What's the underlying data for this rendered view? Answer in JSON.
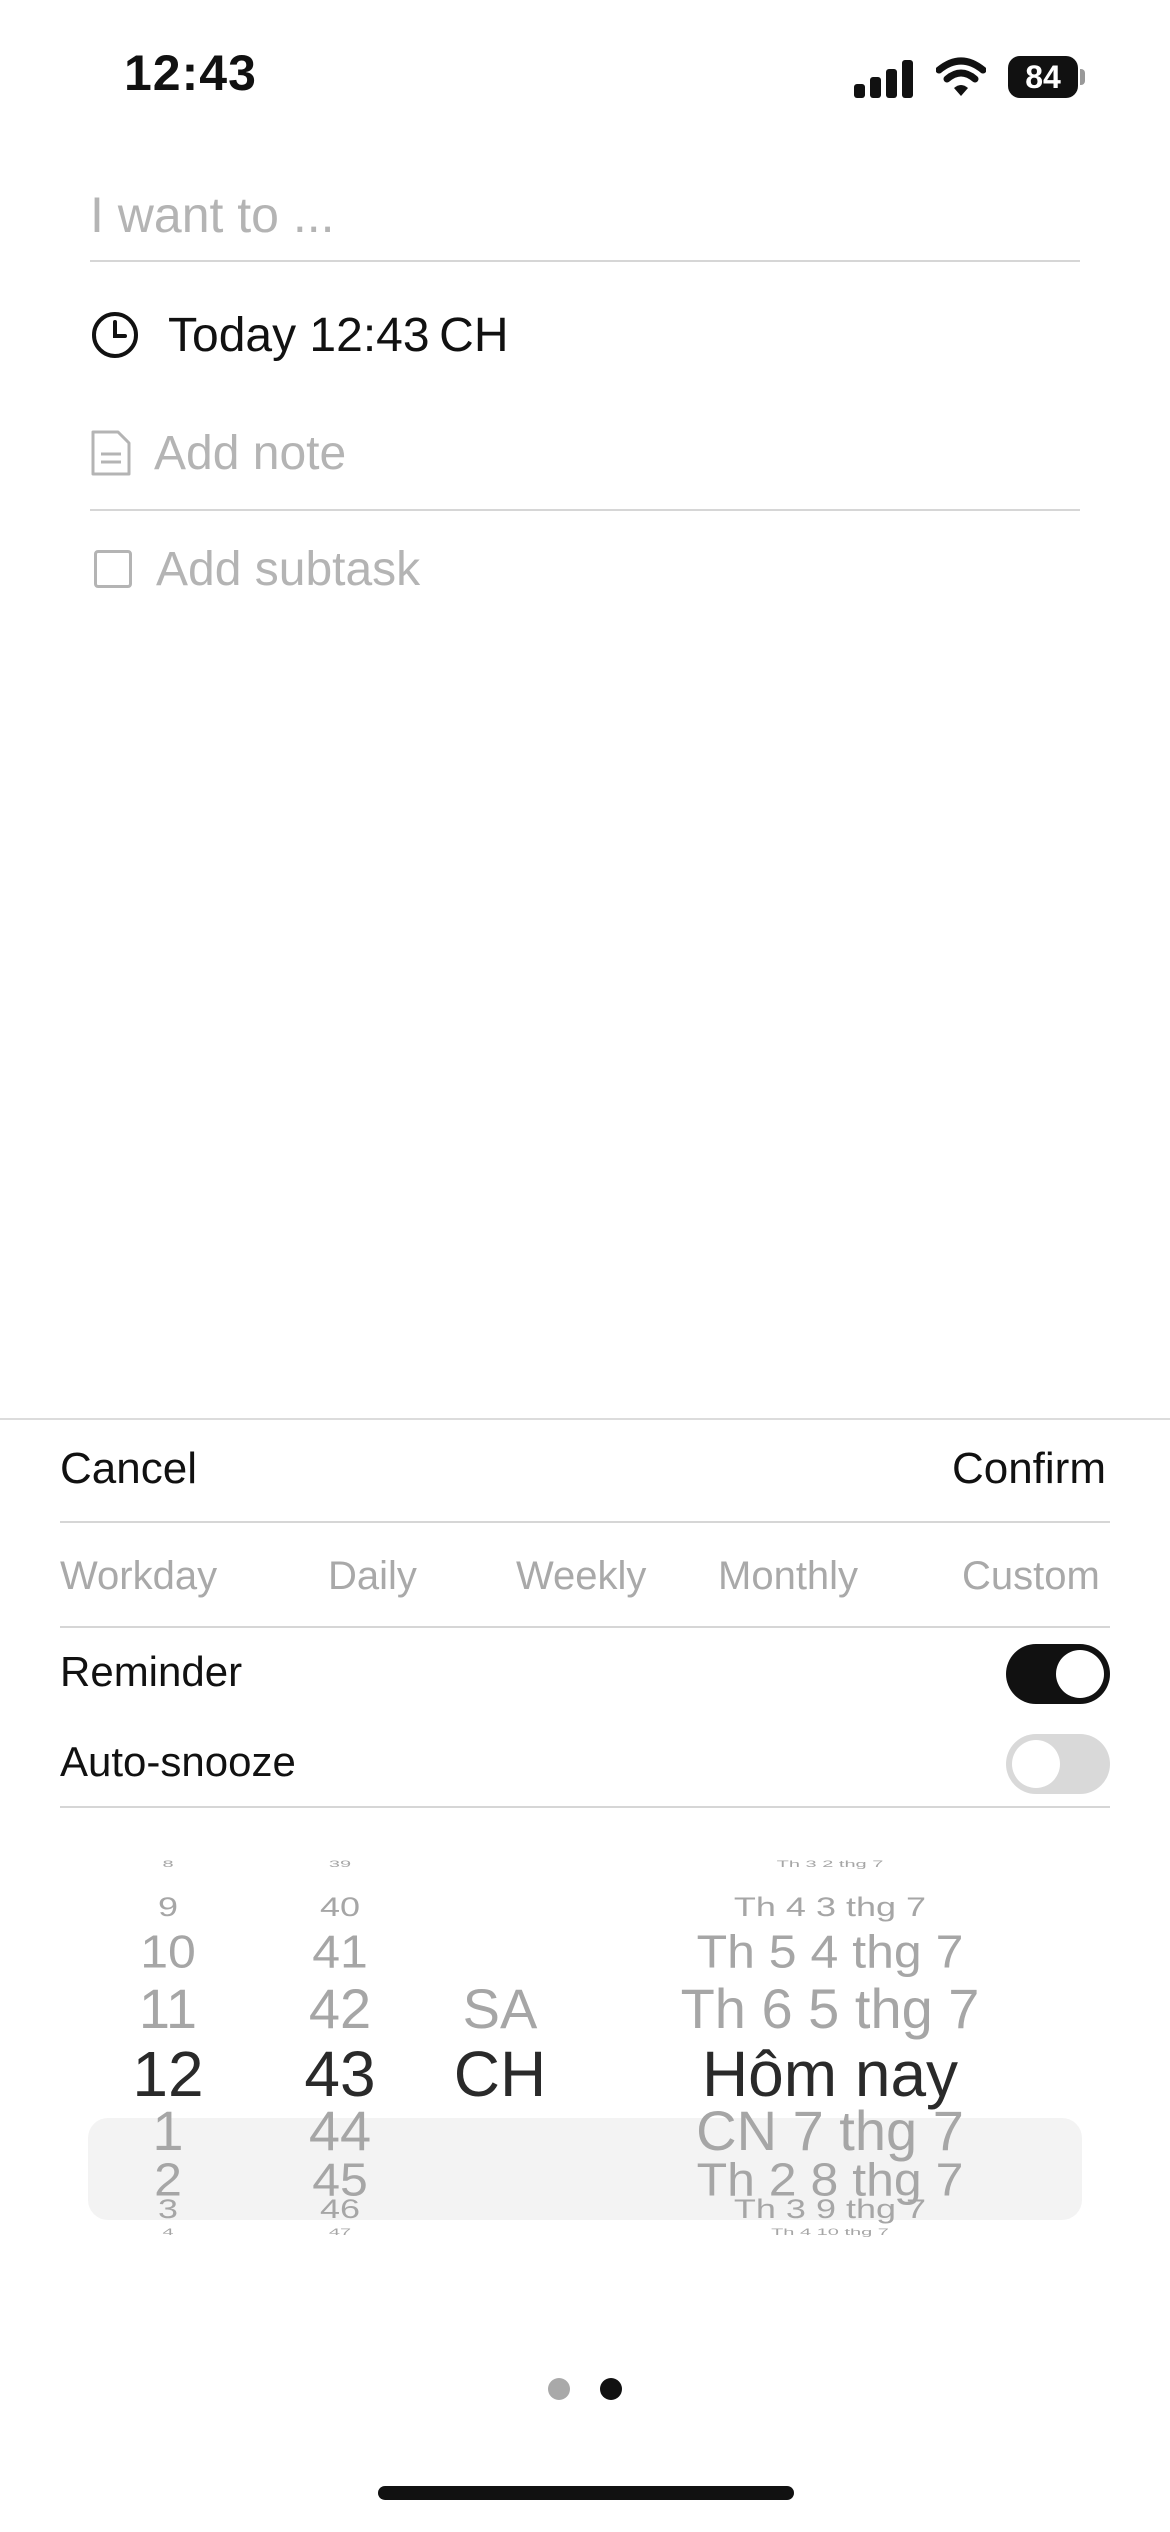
{
  "status_bar": {
    "time": "12:43",
    "battery": "84"
  },
  "task": {
    "title_placeholder": "I want to ...",
    "due": "Today 12:43 CH",
    "note_placeholder": "Add note",
    "subtask_placeholder": "Add subtask"
  },
  "sheet": {
    "cancel": "Cancel",
    "confirm": "Confirm",
    "repeat_options": [
      "Workday",
      "Daily",
      "Weekly",
      "Monthly",
      "Custom"
    ],
    "reminder": {
      "label": "Reminder",
      "on": true
    },
    "auto_snooze": {
      "label": "Auto-snooze",
      "on": false
    }
  },
  "picker": {
    "hours": [
      "8",
      "9",
      "10",
      "11",
      "12",
      "1",
      "2",
      "3",
      "4"
    ],
    "minutes": [
      "39",
      "40",
      "41",
      "42",
      "43",
      "44",
      "45",
      "46",
      "47"
    ],
    "ampm": [
      "SA",
      "CH"
    ],
    "dates": [
      "Th 3 2 thg 7",
      "Th 4 3 thg 7",
      "Th 5 4 thg 7",
      "Th 6 5 thg 7",
      "Hôm nay",
      "CN 7 thg 7",
      "Th 2 8 thg 7",
      "Th 3 9 thg 7",
      "Th 4 10 thg 7"
    ],
    "selected_index": 4
  },
  "colors": {
    "accent": "#111111",
    "placeholder": "#b4b4b4",
    "picker_band": "#f3f3f3"
  }
}
